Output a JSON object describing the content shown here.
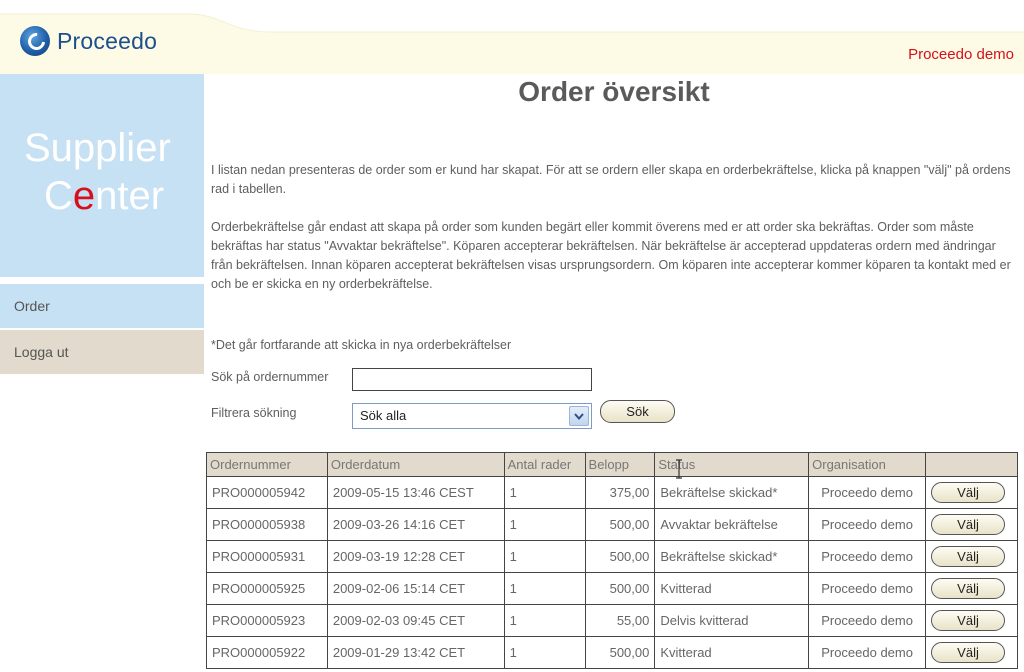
{
  "header": {
    "logo_text": "Proceedo",
    "demo_label": "Proceedo demo"
  },
  "sidebar": {
    "brand_line1": "Supplier",
    "brand_line2_prefix": "C",
    "brand_line2_accent": "e",
    "brand_line2_suffix": "nter",
    "items": [
      {
        "label": "Order"
      },
      {
        "label": "Logga ut"
      }
    ]
  },
  "main": {
    "title": "Order översikt",
    "paragraph1": "I listan nedan presenteras de order som er kund har skapat. För att se ordern eller skapa en orderbekräftelse, klicka på knappen \"välj\" på ordens rad i tabellen.",
    "paragraph2": "Orderbekräftelse går endast att skapa på order som kunden begärt eller kommit överens med er att order ska bekräftas. Order som måste bekräftas har status \"Avvaktar bekräftelse\". Köparen accepterar bekräftelsen. När bekräftelse är accepterad uppdateras ordern med ändringar från bekräftelsen. Innan köparen accepterat bekräftelsen visas ursprungsordern. Om köparen inte accepterar kommer köparen ta kontakt med er och be er skicka en ny orderbekräftelse.",
    "note": "*Det går fortfarande att skicka in nya orderbekräftelser"
  },
  "search": {
    "label": "Sök på ordernummer",
    "value": "",
    "filter_label": "Filtrera sökning",
    "filter_selected": "Sök alla",
    "button_label": "Sök"
  },
  "table": {
    "headers": [
      "Ordernummer",
      "Orderdatum",
      "Antal rader",
      "Belopp",
      "Status",
      "Organisation",
      ""
    ],
    "choose_label": "Välj",
    "rows": [
      {
        "ordernr": "PRO000005942",
        "date": "2009-05-15 13:46 CEST",
        "rows": "1",
        "amount": "375,00",
        "status": "Bekräftelse skickad*",
        "org": "Proceedo demo"
      },
      {
        "ordernr": "PRO000005938",
        "date": "2009-03-26 14:16 CET",
        "rows": "1",
        "amount": "500,00",
        "status": "Avvaktar bekräftelse",
        "org": "Proceedo demo"
      },
      {
        "ordernr": "PRO000005931",
        "date": "2009-03-19 12:28 CET",
        "rows": "1",
        "amount": "500,00",
        "status": "Bekräftelse skickad*",
        "org": "Proceedo demo"
      },
      {
        "ordernr": "PRO000005925",
        "date": "2009-02-06 15:14 CET",
        "rows": "1",
        "amount": "500,00",
        "status": "Kvitterad",
        "org": "Proceedo demo"
      },
      {
        "ordernr": "PRO000005923",
        "date": "2009-02-03 09:45 CET",
        "rows": "1",
        "amount": "55,00",
        "status": "Delvis kvitterad",
        "org": "Proceedo demo"
      },
      {
        "ordernr": "PRO000005922",
        "date": "2009-01-29 13:42 CET",
        "rows": "1",
        "amount": "500,00",
        "status": "Kvitterad",
        "org": "Proceedo demo"
      }
    ]
  },
  "colors": {
    "header_band": "#fdfbe6",
    "sidebar_blue": "#c6e0f4",
    "sidebar_beige": "#e2dbcd",
    "accent_red": "#d4111b",
    "logo_blue": "#1c4f8c"
  }
}
